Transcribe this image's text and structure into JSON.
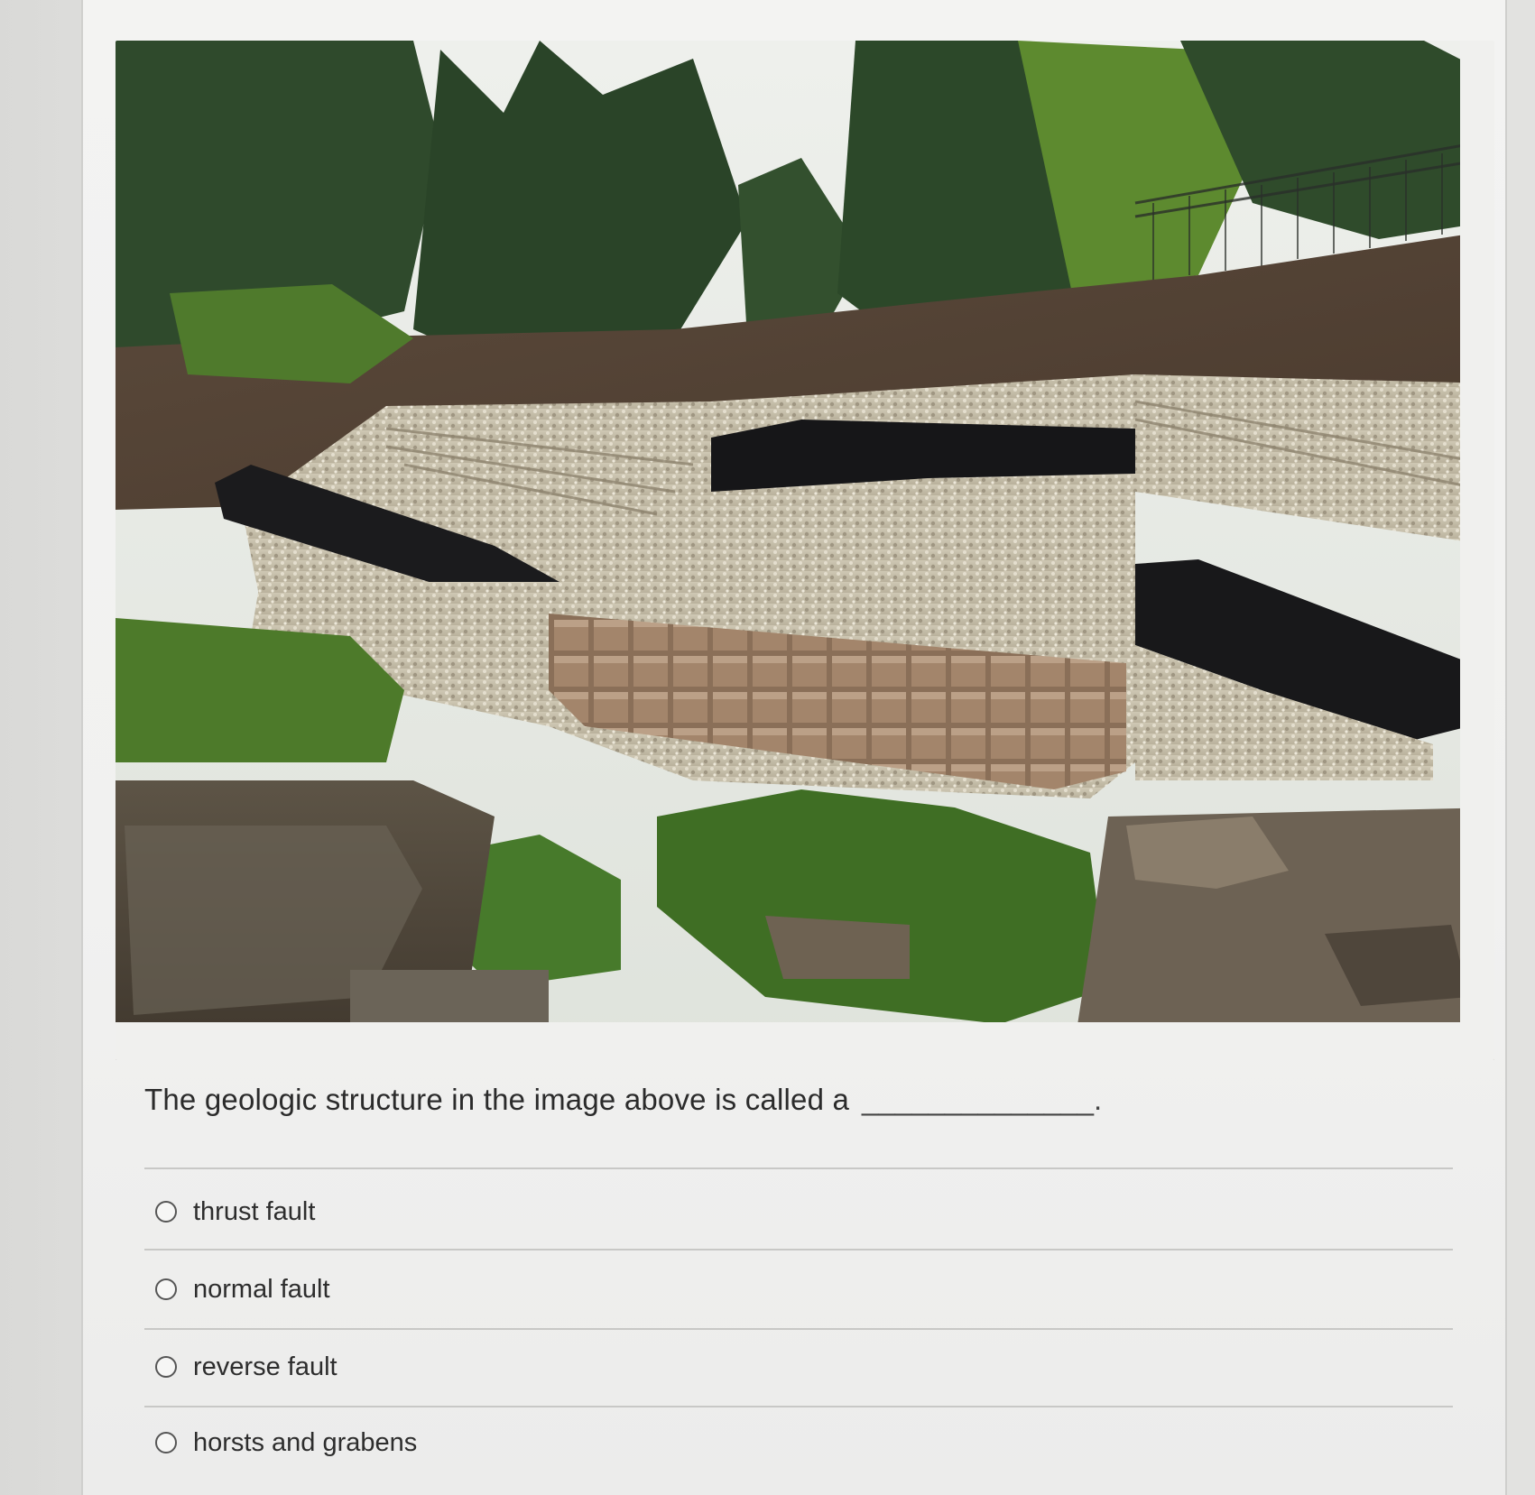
{
  "question": {
    "text": "The geologic structure in the image above is called a",
    "blank": "______________."
  },
  "options": [
    {
      "label": "thrust fault",
      "selected": false
    },
    {
      "label": "normal fault",
      "selected": false
    },
    {
      "label": "reverse fault",
      "selected": false
    },
    {
      "label": "horsts and grabens",
      "selected": false
    }
  ],
  "image": {
    "subject": "photo of tilted rock strata with dark coal seams offset along a fault, with trees and vegetation"
  }
}
